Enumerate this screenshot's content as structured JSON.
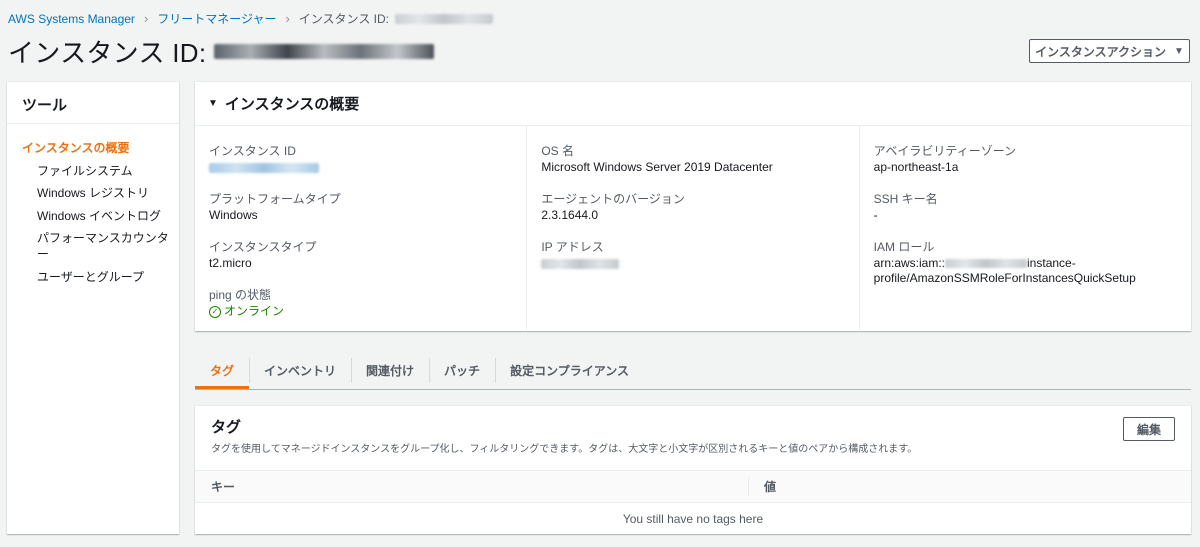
{
  "breadcrumb": {
    "items": [
      "AWS Systems Manager",
      "フリートマネージャー",
      "インスタンス ID:"
    ]
  },
  "page": {
    "title": "インスタンス ID:",
    "actions_label": "インスタンスアクション"
  },
  "sidebar": {
    "heading": "ツール",
    "items": [
      {
        "label": "インスタンスの概要",
        "active": true
      },
      {
        "label": "ファイルシステム"
      },
      {
        "label": "Windows レジストリ"
      },
      {
        "label": "Windows イベントログ"
      },
      {
        "label": "パフォーマンスカウンター"
      },
      {
        "label": "ユーザーとグループ"
      }
    ]
  },
  "overview": {
    "heading": "インスタンスの概要",
    "col1": {
      "instance_id_label": "インスタンス ID",
      "platform_label": "プラットフォームタイプ",
      "platform_value": "Windows",
      "type_label": "インスタンスタイプ",
      "type_value": "t2.micro",
      "ping_label": "ping の状態",
      "ping_value": "オンライン"
    },
    "col2": {
      "os_label": "OS 名",
      "os_value": "Microsoft Windows Server 2019 Datacenter",
      "agent_label": "エージェントのバージョン",
      "agent_value": "2.3.1644.0",
      "ip_label": "IP アドレス"
    },
    "col3": {
      "az_label": "アベイラビリティーゾーン",
      "az_value": "ap-northeast-1a",
      "ssh_label": "SSH キー名",
      "ssh_value": "-",
      "iam_label": "IAM ロール",
      "iam_prefix": "arn:aws:iam::",
      "iam_suffix": "instance-",
      "iam_line2": "profile/AmazonSSMRoleForInstancesQuickSetup"
    }
  },
  "tabs": [
    {
      "label": "タグ",
      "active": true
    },
    {
      "label": "インベントリ"
    },
    {
      "label": "関連付け"
    },
    {
      "label": "パッチ"
    },
    {
      "label": "設定コンプライアンス"
    }
  ],
  "tags": {
    "title": "タグ",
    "description": "タグを使用してマネージドインスタンスをグループ化し、フィルタリングできます。タグは、大文字と小文字が区別されるキーと値のペアから構成されます。",
    "edit_label": "編集",
    "col_key": "キー",
    "col_value": "値",
    "empty": "You still have no tags here"
  },
  "colors": {
    "accent": "#ec7211",
    "link": "#0073bb",
    "success": "#1d8102"
  }
}
